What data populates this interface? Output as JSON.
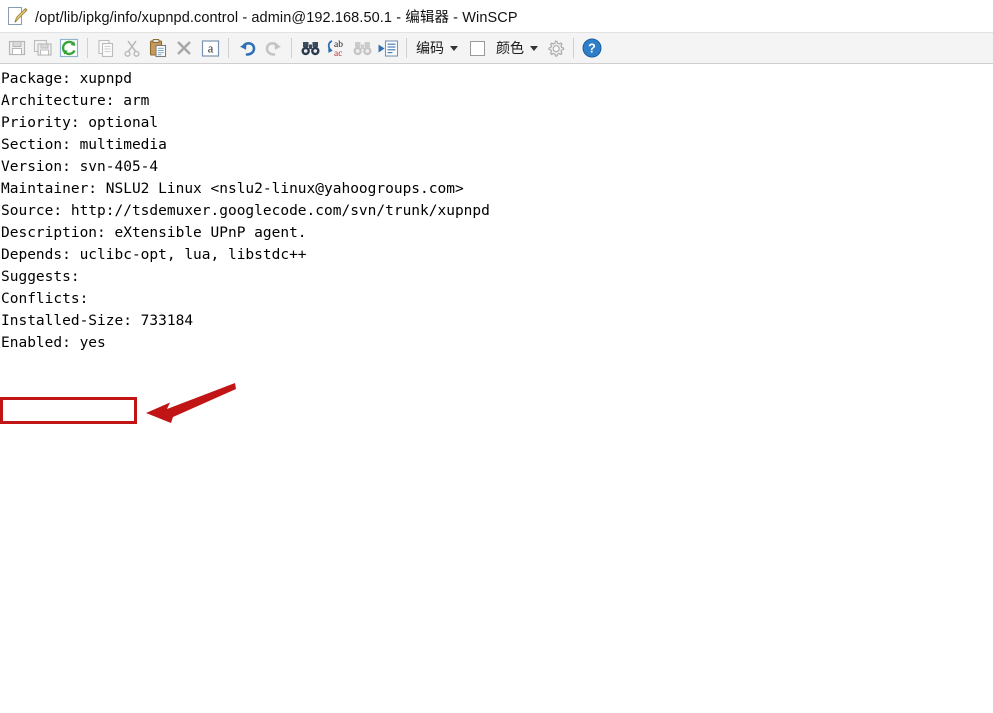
{
  "window": {
    "icon": "document-pencil-icon",
    "title": "/opt/lib/ipkg/info/xupnpd.control - admin@192.168.50.1 - 编辑器 - WinSCP",
    "file_path": "/opt/lib/ipkg/info/xupnpd.control",
    "session": "admin@192.168.50.1",
    "app_mode": "编辑器",
    "app_name": "WinSCP"
  },
  "toolbar": {
    "buttons": [
      {
        "name": "save-button",
        "icon": "floppy-disk-icon",
        "enabled": false
      },
      {
        "name": "save-as-button",
        "icon": "floppy-disk-copy-icon",
        "enabled": false
      },
      {
        "name": "reload-button",
        "icon": "refresh-icon",
        "enabled": true
      },
      {
        "name": "copy-button",
        "icon": "copy-icon",
        "enabled": false
      },
      {
        "name": "cut-button",
        "icon": "scissors-icon",
        "enabled": false
      },
      {
        "name": "paste-button",
        "icon": "clipboard-paste-icon",
        "enabled": true
      },
      {
        "name": "delete-button",
        "icon": "close-x-icon",
        "enabled": false
      },
      {
        "name": "select-all-button",
        "icon": "letter-a-box-icon",
        "enabled": true
      },
      {
        "name": "undo-button",
        "icon": "undo-arrow-icon",
        "enabled": true
      },
      {
        "name": "redo-button",
        "icon": "redo-arrow-icon",
        "enabled": false
      },
      {
        "name": "find-button",
        "icon": "binoculars-icon",
        "enabled": true
      },
      {
        "name": "replace-button",
        "icon": "replace-ab-ac-icon",
        "enabled": true
      },
      {
        "name": "find-next-button",
        "icon": "binoculars-next-icon",
        "enabled": false
      },
      {
        "name": "go-to-line-button",
        "icon": "go-to-line-icon",
        "enabled": true
      },
      {
        "name": "preferences-button",
        "icon": "gear-icon",
        "enabled": false
      },
      {
        "name": "help-button",
        "icon": "question-mark-icon",
        "enabled": true
      }
    ],
    "encoding_label": "编码",
    "wordwrap_checked": false,
    "color_label": "颜色"
  },
  "editor": {
    "lines": [
      "Package: xupnpd",
      "Architecture: arm",
      "Priority: optional",
      "Section: multimedia",
      "Version: svn-405-4",
      "Maintainer: NSLU2 Linux <nslu2-linux@yahoogroups.com>",
      "Source: http://tsdemuxer.googlecode.com/svn/trunk/xupnpd",
      "Description: eXtensible UPnP agent.",
      "Depends: uclibc-opt, lua, libstdc++",
      "Suggests:",
      "Conflicts:",
      "Installed-Size: 733184",
      "Enabled: yes"
    ],
    "text": "Package: xupnpd\nArchitecture: arm\nPriority: optional\nSection: multimedia\nVersion: svn-405-4\nMaintainer: NSLU2 Linux <nslu2-linux@yahoogroups.com>\nSource: http://tsdemuxer.googlecode.com/svn/trunk/xupnpd\nDescription: eXtensible UPnP agent.\nDepends: uclibc-opt, lua, libstdc++\nSuggests:\nConflicts:\nInstalled-Size: 733184\nEnabled: yes"
  },
  "annotations": {
    "highlight_color": "#C11515",
    "highlighted_text": "Enabled: yes",
    "arrow_color": "#C11515"
  }
}
